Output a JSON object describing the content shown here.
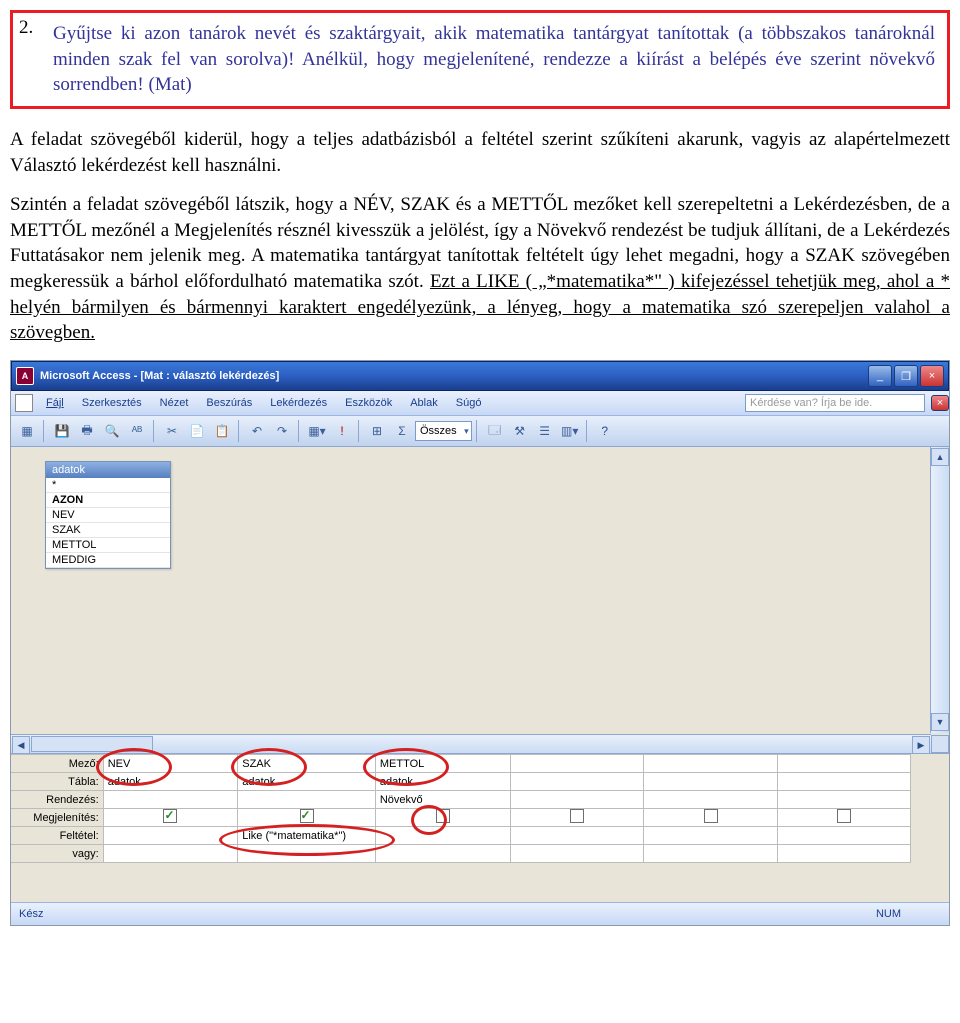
{
  "task": {
    "number": "2.",
    "text": "Gyűjtse ki azon tanárok nevét és szaktárgyait, akik matematika tantárgyat tanítottak (a többszakos tanároknál minden szak fel van sorolva)! Anélkül, hogy megjelenítené, rendezze a kiírást a belépés éve szerint növekvő sorrendben! (Mat)"
  },
  "para1": "A feladat szövegéből kiderül, hogy a teljes adatbázisból a feltétel szerint szűkíteni akarunk, vagyis az alapértelmezett Választó lekérdezést kell használni.",
  "para2_a": "Szintén a feladat szövegéből látszik, hogy a NÉV, SZAK és a METTŐL mezőket kell szerepeltetni a Lekérdezésben, de a METTŐL mezőnél a Megjelenítés résznél kivesszük a jelölést, így a Növekvő rendezést be tudjuk állítani, de a Lekérdezés Futtatásakor nem jelenik meg. A matematika tantárgyat tanítottak feltételt úgy lehet megadni, hogy a SZAK szövegében megkeressük a bárhol előfordulható matematika szót. ",
  "para2_b": "Ezt a LIKE ( „*matematika*\" ) kifejezéssel tehetjük meg, ahol a * helyén bármilyen és bármennyi karaktert engedélyezünk, a lényeg, hogy a matematika szó szerepeljen valahol a szövegben.",
  "access": {
    "title": "Microsoft Access - [Mat : választó lekérdezés]",
    "menus": [
      "Fájl",
      "Szerkesztés",
      "Nézet",
      "Beszúrás",
      "Lekérdezés",
      "Eszközök",
      "Ablak",
      "Súgó"
    ],
    "search_placeholder": "Kérdése van? Írja be ide.",
    "toolbar_combo": "Összes",
    "table": {
      "name": "adatok",
      "fields": [
        "*",
        "AZON",
        "NEV",
        "SZAK",
        "METTOL",
        "MEDDIG"
      ]
    },
    "qbe": {
      "labels": {
        "field": "Mező:",
        "table": "Tábla:",
        "sort": "Rendezés:",
        "show": "Megjelenítés:",
        "criteria": "Feltétel:",
        "or": "vagy:"
      },
      "cols": [
        {
          "field": "NEV",
          "table": "adatok",
          "sort": "",
          "show": true,
          "criteria": ""
        },
        {
          "field": "SZAK",
          "table": "adatok",
          "sort": "",
          "show": true,
          "criteria": "Like (\"*matematika*\")"
        },
        {
          "field": "METTOL",
          "table": "adatok",
          "sort": "Növekvő",
          "show": false,
          "criteria": ""
        }
      ]
    },
    "status_left": "Kész",
    "status_num": "NUM"
  }
}
